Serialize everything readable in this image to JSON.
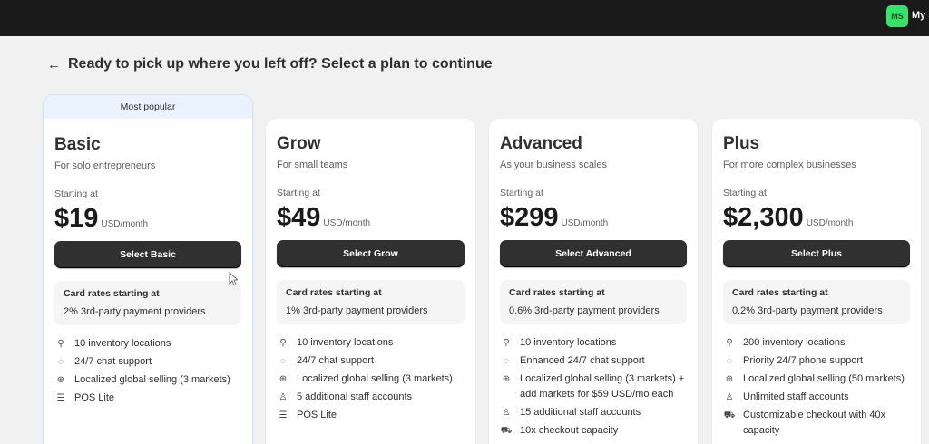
{
  "topbar": {
    "avatar_initials": "MS",
    "store_name": "My Store"
  },
  "page": {
    "title": "Ready to pick up where you left off? Select a plan to continue",
    "back_icon": "arrow-left-icon"
  },
  "plans": [
    {
      "banner": "Most popular",
      "name": "Basic",
      "description": "For solo entrepreneurs",
      "starting_label": "Starting at",
      "price": "$19",
      "price_unit": "USD/month",
      "button": "Select Basic",
      "rates_title": "Card rates starting at",
      "rates_value": "2% 3rd-party payment providers",
      "features": [
        {
          "icon": "location-pin-icon",
          "text": "10 inventory locations"
        },
        {
          "icon": "chat-icon",
          "text": "24/7 chat support"
        },
        {
          "icon": "globe-icon",
          "text": "Localized global selling (3 markets)"
        },
        {
          "icon": "pos-icon",
          "text": "POS Lite"
        }
      ]
    },
    {
      "name": "Grow",
      "description": "For small teams",
      "starting_label": "Starting at",
      "price": "$49",
      "price_unit": "USD/month",
      "button": "Select Grow",
      "rates_title": "Card rates starting at",
      "rates_value": "1% 3rd-party payment providers",
      "features": [
        {
          "icon": "location-pin-icon",
          "text": "10 inventory locations"
        },
        {
          "icon": "chat-icon",
          "text": "24/7 chat support"
        },
        {
          "icon": "globe-icon",
          "text": "Localized global selling (3 markets)"
        },
        {
          "icon": "person-icon",
          "text": "5 additional staff accounts"
        },
        {
          "icon": "pos-icon",
          "text": "POS Lite"
        }
      ]
    },
    {
      "name": "Advanced",
      "description": "As your business scales",
      "starting_label": "Starting at",
      "price": "$299",
      "price_unit": "USD/month",
      "button": "Select Advanced",
      "rates_title": "Card rates starting at",
      "rates_value": "0.6% 3rd-party payment providers",
      "features": [
        {
          "icon": "location-pin-icon",
          "text": "10 inventory locations"
        },
        {
          "icon": "chat-icon",
          "text": "Enhanced 24/7 chat support"
        },
        {
          "icon": "globe-icon",
          "text": "Localized global selling (3 markets) + add markets for $59 USD/mo each"
        },
        {
          "icon": "person-icon",
          "text": "15 additional staff accounts"
        },
        {
          "icon": "cart-icon",
          "text": "10x checkout capacity"
        }
      ]
    },
    {
      "name": "Plus",
      "description": "For more complex businesses",
      "starting_label": "Starting at",
      "price": "$2,300",
      "price_unit": "USD/month",
      "button": "Select Plus",
      "rates_title": "Card rates starting at",
      "rates_value": "0.2% 3rd-party payment providers",
      "features": [
        {
          "icon": "location-pin-icon",
          "text": "200 inventory locations"
        },
        {
          "icon": "chat-icon",
          "text": "Priority 24/7 phone support"
        },
        {
          "icon": "globe-icon",
          "text": "Localized global selling (50 markets)"
        },
        {
          "icon": "person-icon",
          "text": "Unlimited staff accounts"
        },
        {
          "icon": "cart-icon",
          "text": "Customizable checkout with 40x capacity"
        }
      ]
    }
  ]
}
